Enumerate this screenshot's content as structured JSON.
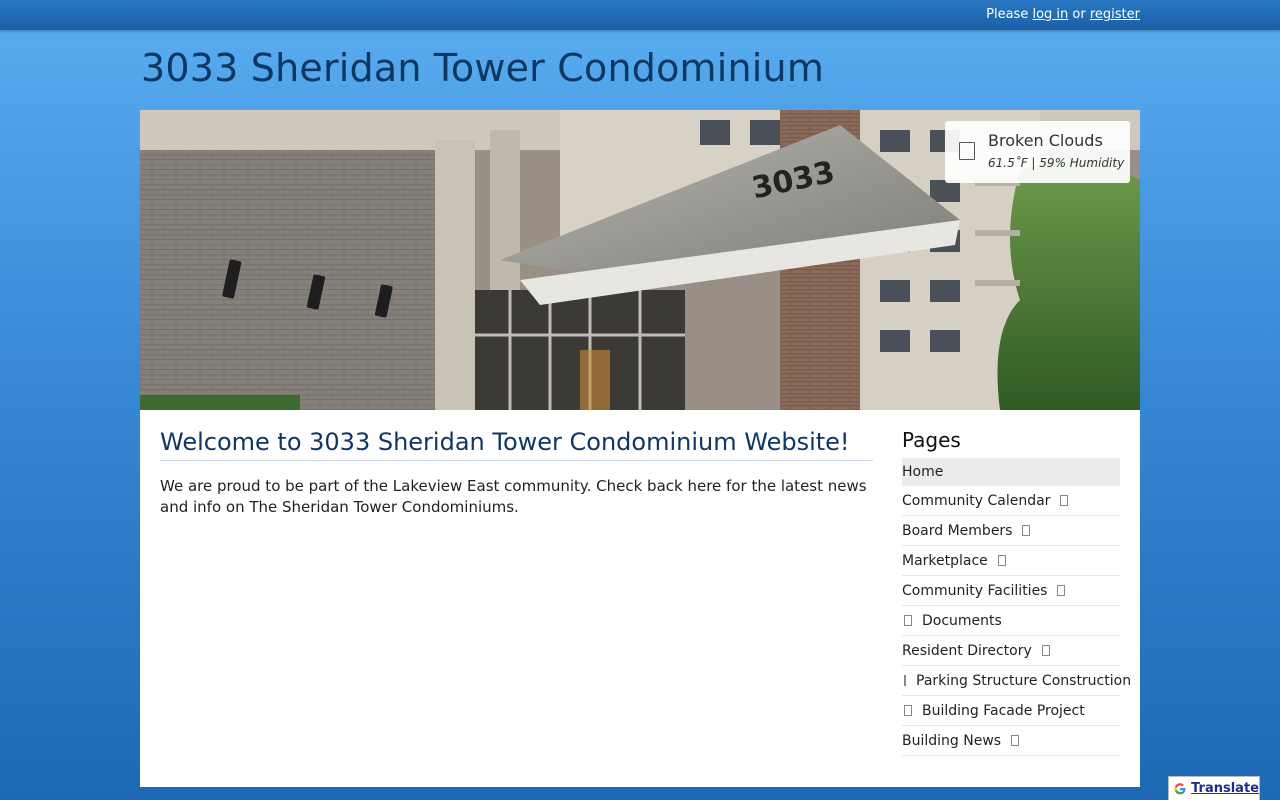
{
  "topbar": {
    "prefix": "Please",
    "login": "log in",
    "or": "or",
    "register": "register"
  },
  "site": {
    "title": "3033 Sheridan Tower Condominium"
  },
  "hero": {
    "building_number": "3033",
    "weather": {
      "icon": "weather-icon",
      "condition": "Broken Clouds",
      "details": "61.5˚F | 59% Humidity"
    }
  },
  "main": {
    "heading": "Welcome to 3033 Sheridan Tower Condominium Website!",
    "text": "We are proud to be part of the Lakeview East community. Check back here for the latest news and info on The Sheridan Tower Condominiums."
  },
  "pages": {
    "title": "Pages",
    "items": [
      {
        "label": "Home"
      },
      {
        "label": "Community Calendar"
      },
      {
        "label": "Board Members"
      },
      {
        "label": "Marketplace"
      },
      {
        "label": "Community Facilities"
      },
      {
        "label": "Documents"
      },
      {
        "label": "Resident Directory"
      },
      {
        "label": "Parking Structure Construction"
      },
      {
        "label": "Building Facade Project"
      },
      {
        "label": "Building News"
      }
    ]
  },
  "translate": {
    "label": "Translate"
  },
  "colors": {
    "title": "#0e3763",
    "topbar": "#1b5fa6",
    "background_top": "#5aaef0",
    "background_bottom": "#1d68b3"
  }
}
